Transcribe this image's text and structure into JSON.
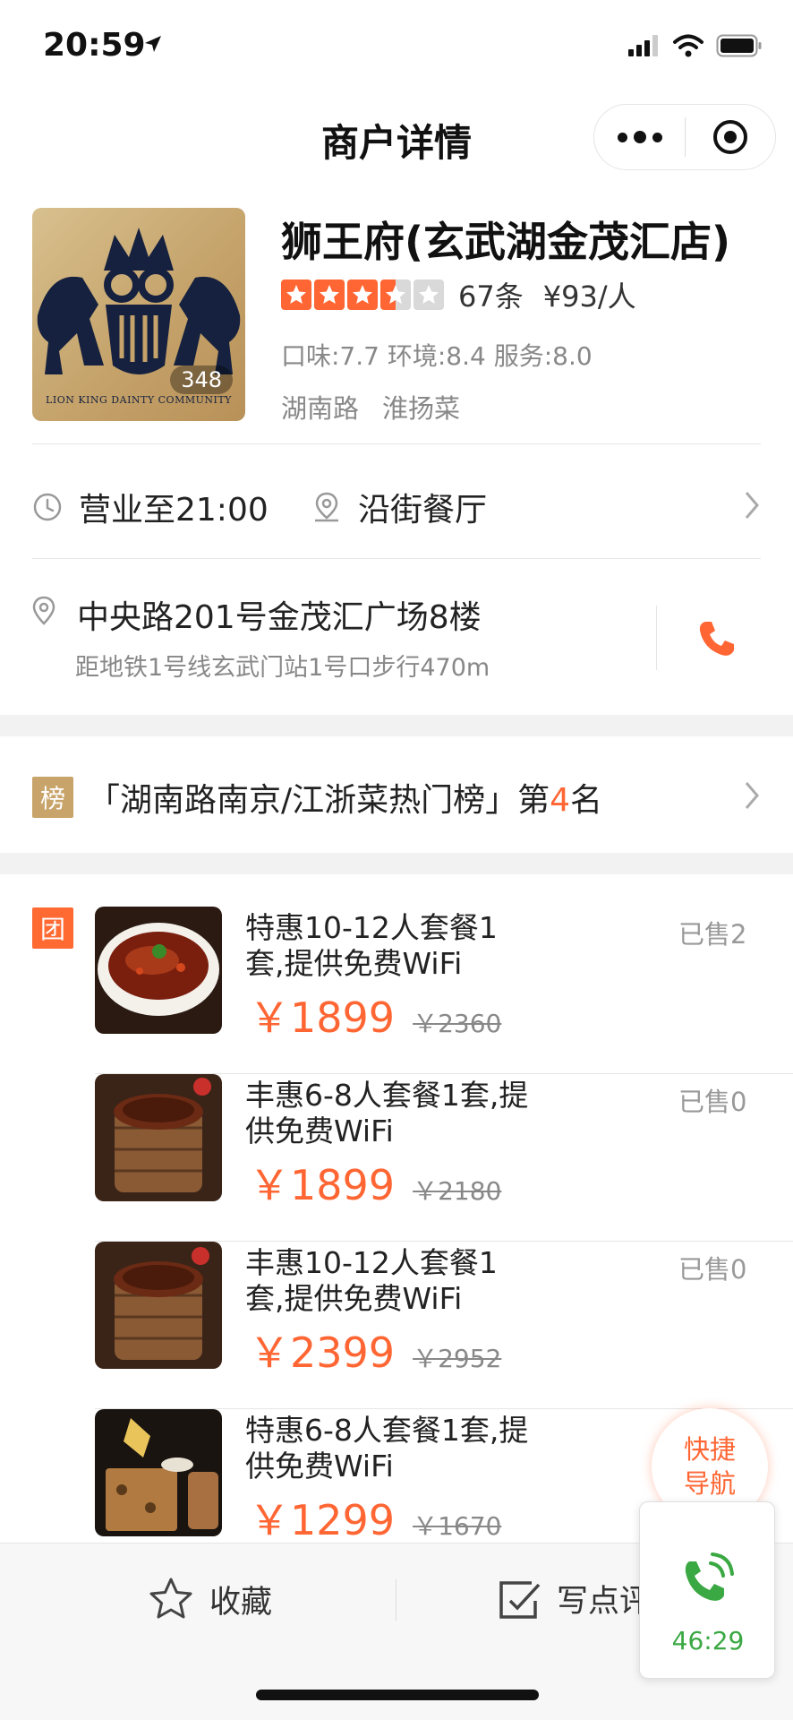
{
  "status_bar": {
    "time": "20:59"
  },
  "nav": {
    "title": "商户详情"
  },
  "shop": {
    "name": "狮王府(玄武湖金茂汇店)",
    "logo_text": "LION KING DAINTY COMMUNITY",
    "photo_count": "348",
    "rating_stars": 3.5,
    "reviews": "67条",
    "avg_price": "¥93/人",
    "scores": "口味:7.7 环境:8.4 服务:8.0",
    "tags": [
      "湖南路",
      "淮扬菜"
    ]
  },
  "info": {
    "hours": "营业至21:00",
    "type": "沿街餐厅"
  },
  "address": {
    "main": "中央路201号金茂汇广场8楼",
    "sub": "距地铁1号线玄武门站1号口步行470m"
  },
  "ranking": {
    "badge": "榜",
    "prefix": "「湖南路南京/江浙菜热门榜」第",
    "rank": "4",
    "suffix": "名"
  },
  "deals": {
    "badge": "团",
    "items": [
      {
        "title": "特惠10-12人套餐1套,提供免费WiFi",
        "sold": "已售2",
        "price": "￥1899",
        "original": "￥2360"
      },
      {
        "title": "丰惠6-8人套餐1套,提供免费WiFi",
        "sold": "已售0",
        "price": "￥1899",
        "original": "￥2180"
      },
      {
        "title": "丰惠10-12人套餐1套,提供免费WiFi",
        "sold": "已售0",
        "price": "￥2399",
        "original": "￥2952"
      },
      {
        "title": "特惠6-8人套餐1套,提供免费WiFi",
        "sold": "",
        "price": "￥1299",
        "original": "￥1670"
      }
    ]
  },
  "quick_nav": {
    "line1": "快捷",
    "line2": "导航"
  },
  "call": {
    "timer": "46:29"
  },
  "bottom_bar": {
    "favorite": "收藏",
    "review": "写点评"
  },
  "colors": {
    "accent": "#ff6633",
    "star": "#ff6633",
    "rank_badge": "#c9a46a",
    "call_green": "#3aa843"
  }
}
